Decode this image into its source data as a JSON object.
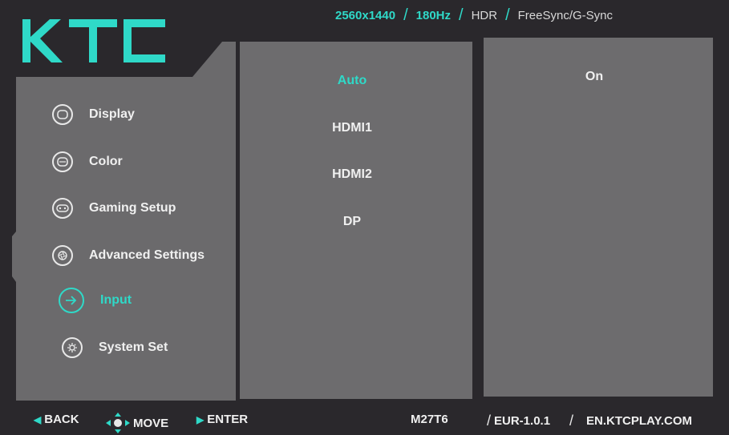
{
  "brand": {
    "logo_text": "KTC"
  },
  "spec_bar": {
    "resolution": "2560x1440",
    "refresh": "180Hz",
    "hdr": "HDR",
    "sync": "FreeSync/G-Sync"
  },
  "sidebar": {
    "items": [
      {
        "label": "Display",
        "icon": "display-icon"
      },
      {
        "label": "Color",
        "icon": "color-icon"
      },
      {
        "label": "Gaming Setup",
        "icon": "gamepad-icon"
      },
      {
        "label": "Advanced Settings",
        "icon": "aperture-icon"
      },
      {
        "label": "Input",
        "icon": "input-arrow-icon",
        "active": true
      },
      {
        "label": "System Set",
        "icon": "gear-icon"
      }
    ]
  },
  "input_options": {
    "items": [
      "Auto",
      "HDMI1",
      "HDMI2",
      "DP"
    ],
    "selected": "Auto"
  },
  "right_panel": {
    "value": "On"
  },
  "footer": {
    "back": "BACK",
    "move": "MOVE",
    "enter": "ENTER",
    "model": "M27T6",
    "firmware": "EUR-1.0.1",
    "website": "EN.KTCPLAY.COM"
  },
  "colors": {
    "accent": "#2fd9c8",
    "panel": "#6d6c6e",
    "background": "#2a282c"
  }
}
